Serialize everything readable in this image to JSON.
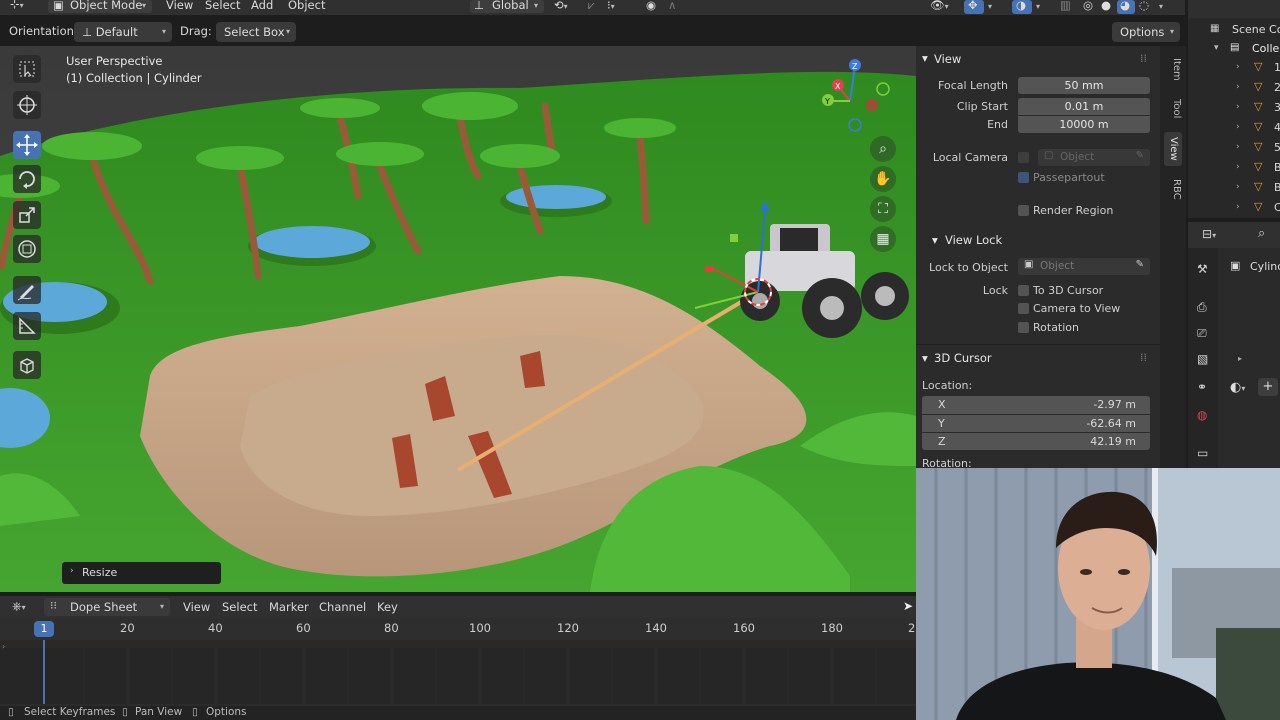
{
  "header": {
    "mode": "Object Mode",
    "menus": [
      "View",
      "Select",
      "Add",
      "Object"
    ],
    "transform_orientation": "Global"
  },
  "tool_options": {
    "orientation_label": "Orientation:",
    "orientation_value": "Default",
    "drag_label": "Drag:",
    "drag_value": "Select Box",
    "options_label": "Options"
  },
  "viewport": {
    "perspective": "User Perspective",
    "collection": "(1) Collection | Cylinder",
    "last_operator": "Resize",
    "gizmo": {
      "z": "Z",
      "x": "X",
      "y": "Y"
    }
  },
  "npanel": {
    "view_header": "View",
    "focal_length_label": "Focal Length",
    "focal_length_value": "50 mm",
    "clip_start_label": "Clip Start",
    "clip_start_value": "0.01 m",
    "clip_end_label": "End",
    "clip_end_value": "10000 m",
    "local_camera_label": "Local Camera",
    "local_camera_placeholder": "Object",
    "passepartout_label": "Passepartout",
    "render_region_label": "Render Region",
    "view_lock_header": "View Lock",
    "lock_to_object_label": "Lock to Object",
    "lock_to_object_placeholder": "Object",
    "lock_label": "Lock",
    "to_3d_cursor_label": "To 3D Cursor",
    "camera_to_view_label": "Camera to View",
    "rotation_check_label": "Rotation",
    "cursor_header": "3D Cursor",
    "location_label": "Location:",
    "x_label": "X",
    "x_value": "-2.97 m",
    "y_label": "Y",
    "y_value": "-62.64 m",
    "z_label": "Z",
    "z_value": "42.19 m",
    "rotation_label": "Rotation:"
  },
  "ntabs": [
    "Item",
    "Tool",
    "View",
    "RBC"
  ],
  "outliner": {
    "scene": "Scene Co",
    "collection": "Colle",
    "items": [
      "1",
      "2",
      "3",
      "4",
      "5",
      "B",
      "B",
      "C"
    ]
  },
  "properties": {
    "object_name": "Cylinc"
  },
  "dopesheet": {
    "editor": "Dope Sheet",
    "menus": [
      "View",
      "Select",
      "Marker",
      "Channel",
      "Key"
    ],
    "current_frame": "1",
    "frames": [
      "20",
      "40",
      "60",
      "80",
      "100",
      "120",
      "140",
      "160",
      "180",
      "2"
    ]
  },
  "statusbar": {
    "items": [
      "Select Keyframes",
      "Pan View",
      "Options"
    ]
  },
  "colors": {
    "accent": "#4772b3",
    "grass": "#3fa02a",
    "sand": "#c9a888",
    "water": "#5ba8d9"
  }
}
